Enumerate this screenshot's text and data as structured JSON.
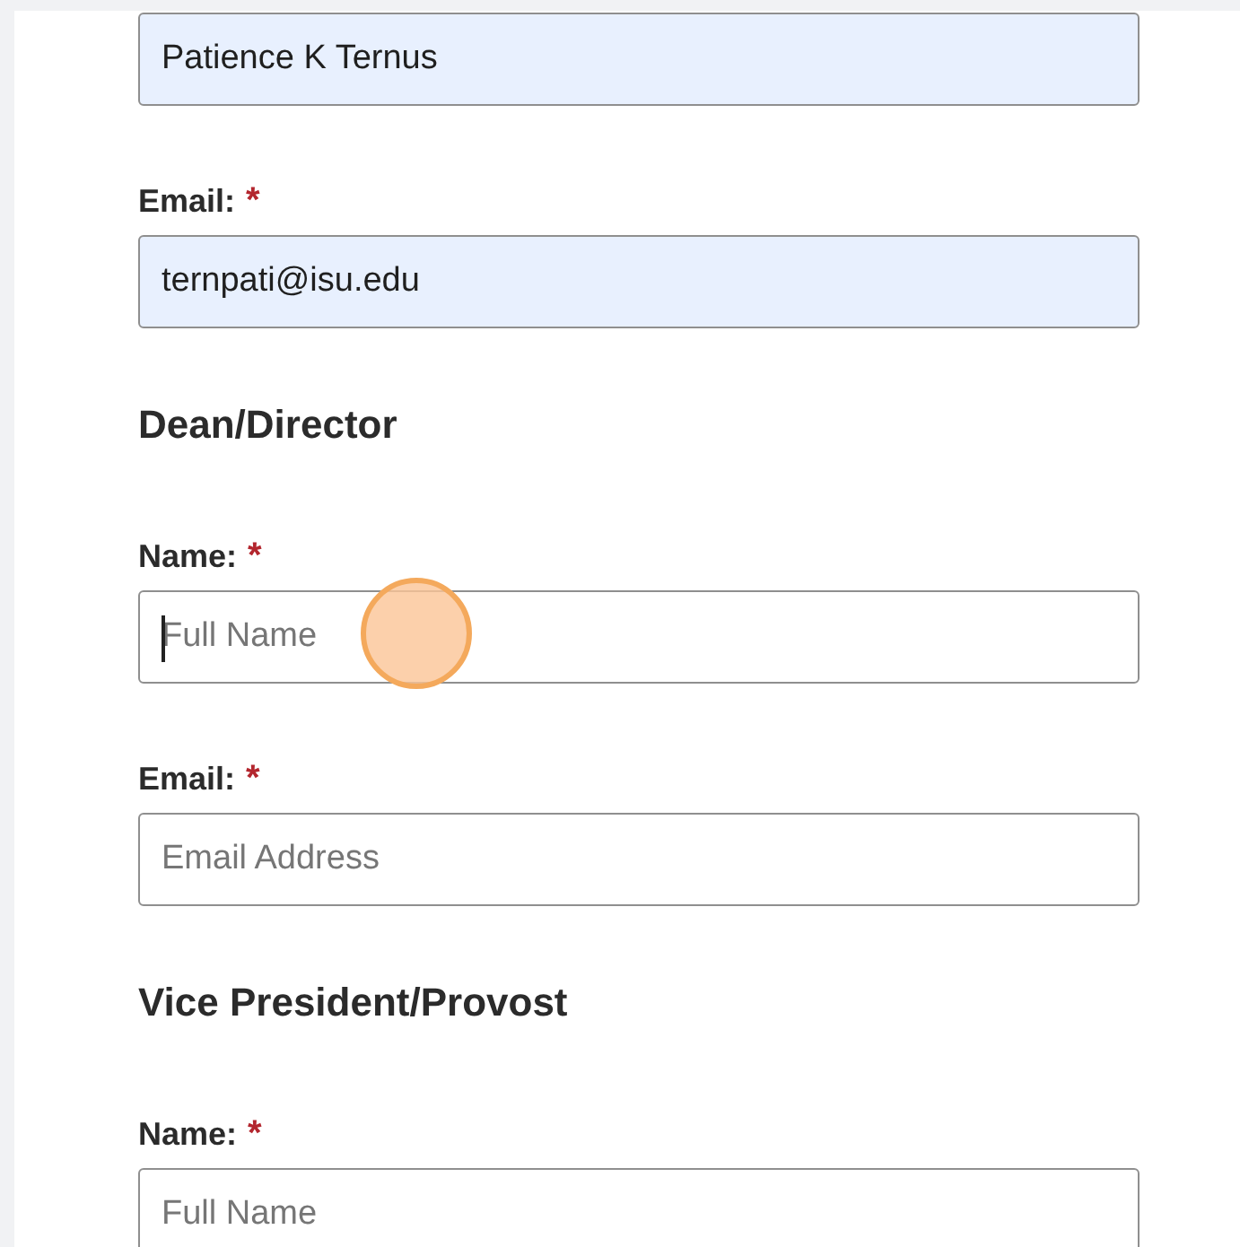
{
  "items": [
    {
      "kind": "field",
      "value": "Patience K Ternus",
      "autofilled": true,
      "focused": false
    },
    {
      "kind": "field",
      "label": "Email:",
      "required_mark": "*",
      "value": "ternpati@isu.edu",
      "autofilled": true,
      "focused": false
    },
    {
      "kind": "heading",
      "text": "Dean/Director"
    },
    {
      "kind": "field",
      "label": "Name:",
      "required_mark": "*",
      "placeholder": "Full Name",
      "autofilled": false,
      "focused": true
    },
    {
      "kind": "field",
      "label": "Email:",
      "required_mark": "*",
      "placeholder": "Email Address",
      "autofilled": false,
      "focused": false
    },
    {
      "kind": "heading",
      "text": "Vice President/Provost"
    },
    {
      "kind": "field",
      "label": "Name:",
      "required_mark": "*",
      "placeholder": "Full Name",
      "autofilled": false,
      "focused": false
    }
  ]
}
